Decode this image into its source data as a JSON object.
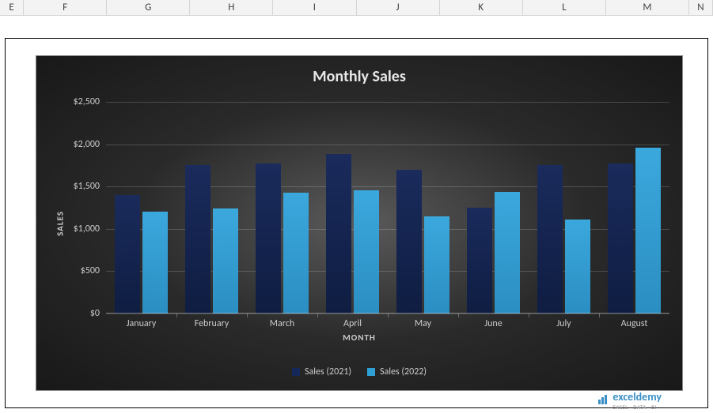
{
  "columns": [
    "E",
    "F",
    "G",
    "H",
    "I",
    "J",
    "K",
    "L",
    "M",
    "N"
  ],
  "chart_data": {
    "type": "bar",
    "title": "Monthly Sales",
    "xlabel": "MONTH",
    "ylabel": "SALES",
    "categories": [
      "January",
      "February",
      "March",
      "April",
      "May",
      "June",
      "July",
      "August"
    ],
    "series": [
      {
        "name": "Sales (2021)",
        "values": [
          1400,
          1750,
          1770,
          1880,
          1700,
          1250,
          1750,
          1770
        ]
      },
      {
        "name": "Sales (2022)",
        "values": [
          1200,
          1240,
          1430,
          1460,
          1150,
          1440,
          1110,
          1960
        ]
      }
    ],
    "ylim": [
      0,
      2500
    ],
    "yticks": [
      "$0",
      "$500",
      "$1,000",
      "$1,500",
      "$2,000",
      "$2,500"
    ],
    "colors": {
      "2021": "#16275a",
      "2022": "#2fa0d6"
    }
  },
  "watermark": {
    "brand": "exceldemy",
    "sub": "EXCEL · DATA · BI"
  }
}
